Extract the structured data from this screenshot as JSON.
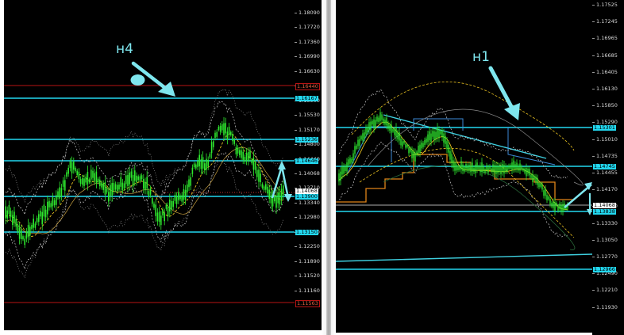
{
  "colors": {
    "background": "#000000",
    "support_resistance": "#22d8f0",
    "red_level": "#b81414",
    "candle": "#2ee82e",
    "bollinger": "#c8c8c8",
    "moving_average": "#e8c020",
    "step_line": "#e08418",
    "trend_line": "#3ed0e0",
    "annotation": "#7ee6ee",
    "axis_text": "#d8d8d8"
  },
  "charts": {
    "left": {
      "timeframe": "н4",
      "axis_labels": [
        "1.18090",
        "1.17720",
        "1.17360",
        "1.16990",
        "1.16630",
        "1.16260",
        "1.15900",
        "1.15530",
        "1.15170",
        "1.14800",
        "1.14440",
        "1.14068",
        "1.13710",
        "1.13340",
        "1.12980",
        "1.12620",
        "1.12250",
        "1.11890",
        "1.11520",
        "1.11160"
      ],
      "tags": [
        {
          "text": "1.16440",
          "kind": "red"
        },
        {
          "text": "1.16167",
          "kind": "cyan"
        },
        {
          "text": "1.15236",
          "kind": "cyan"
        },
        {
          "text": "1.14646",
          "kind": "cyan"
        },
        {
          "text": "1.14068",
          "kind": "current"
        },
        {
          "text": "1.13900",
          "kind": "cyan"
        },
        {
          "text": "1.13150",
          "kind": "cyan"
        },
        {
          "text": "1.11563",
          "kind": "red"
        }
      ]
    },
    "right": {
      "timeframe": "н1",
      "axis_labels": [
        "1.17525",
        "1.17245",
        "1.16965",
        "1.16685",
        "1.16405",
        "1.16130",
        "1.15850",
        "1.15290",
        "1.15010",
        "1.14735",
        "1.14455",
        "1.14170",
        "1.13610",
        "1.13330",
        "1.13050",
        "1.12770",
        "1.12490",
        "1.12210",
        "1.11930"
      ],
      "tags": [
        {
          "text": "1.15301",
          "kind": "cyan"
        },
        {
          "text": "1.14745",
          "kind": "cyan"
        },
        {
          "text": "1.14068",
          "kind": "current"
        },
        {
          "text": "1.13838",
          "kind": "cyan"
        },
        {
          "text": "1.12966",
          "kind": "cyan"
        }
      ]
    }
  }
}
